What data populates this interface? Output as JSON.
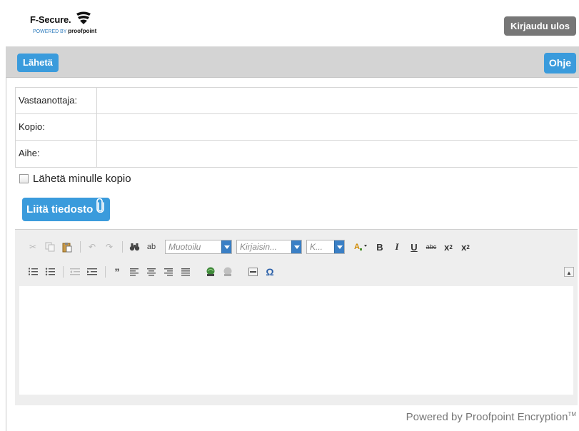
{
  "brand": {
    "name": "F-Secure.",
    "powered_prefix": "POWERED BY",
    "powered_name": "proofpoint",
    "logo_icon": "fsecure-logo-icon"
  },
  "header": {
    "logout_label": "Kirjaudu ulos"
  },
  "toolbar": {
    "send_label": "Lähetä",
    "help_label": "Ohje"
  },
  "form": {
    "to_label": "Vastaanottaja:",
    "to_value": "",
    "cc_label": "Kopio:",
    "cc_value": "",
    "subject_label": "Aihe:",
    "subject_value": "",
    "send_copy_label": "Lähetä minulle kopio",
    "send_copy_checked": false,
    "attach_label": "Liitä tiedosto",
    "attach_icon": "paperclip-icon"
  },
  "editor": {
    "format_combo": "Muotoilu",
    "font_combo": "Kirjaisin...",
    "size_combo": "K...",
    "toolbar_row1": [
      "cut-icon",
      "copy-icon",
      "paste-icon",
      "undo-icon",
      "redo-icon",
      "find-icon",
      "replace-icon",
      "format-combo",
      "font-combo",
      "size-combo",
      "text-color-icon",
      "bold-icon",
      "italic-icon",
      "underline-icon",
      "strikethrough-icon",
      "subscript-icon",
      "superscript-icon"
    ],
    "toolbar_row2": [
      "numbered-list-icon",
      "bulleted-list-icon",
      "outdent-icon",
      "indent-icon",
      "blockquote-icon",
      "align-left-icon",
      "align-center-icon",
      "align-right-icon",
      "justify-icon",
      "link-icon",
      "unlink-icon",
      "horizontal-rule-icon",
      "special-char-icon"
    ],
    "body_text": ""
  },
  "footer": {
    "text": "Powered by Proofpoint Encryption",
    "tm": "TM"
  }
}
